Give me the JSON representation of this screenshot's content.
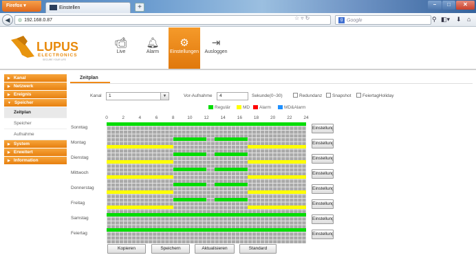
{
  "browser": {
    "firefox_button": "Firefox",
    "tab_title": "Einstellen",
    "url": "192.168.0.87",
    "search_placeholder": "Google",
    "search_engine_letter": "g",
    "new_tab_label": "+"
  },
  "header": {
    "logo_name": "LUPUS",
    "logo_sub": "ELECTRONICS",
    "logo_tag": "SECURE YOUR LIFE",
    "nav": [
      {
        "label": "Live",
        "icon": "camera-icon",
        "active": false
      },
      {
        "label": "Alarm",
        "icon": "bell-icon",
        "active": false
      },
      {
        "label": "Einstellungen",
        "icon": "settings-icon",
        "active": true
      },
      {
        "label": "Ausloggen",
        "icon": "logout-icon",
        "active": false
      }
    ]
  },
  "sidebar": {
    "groups": [
      {
        "label": "Kanal",
        "expanded": false
      },
      {
        "label": "Netzwerk",
        "expanded": false
      },
      {
        "label": "Ereignis",
        "expanded": false
      },
      {
        "label": "Speicher",
        "expanded": true,
        "items": [
          "Zeitplan",
          "Speicher",
          "Aufnahme"
        ],
        "active_item": "Zeitplan"
      },
      {
        "label": "System",
        "expanded": false
      },
      {
        "label": "Erweitert",
        "expanded": false
      },
      {
        "label": "Information",
        "expanded": false
      }
    ]
  },
  "content": {
    "tab": "Zeitplan",
    "kanal_label": "Kanal",
    "kanal_value": "1",
    "prerecord_label": "Vor-Aufnahme",
    "prerecord_value": "4",
    "prerecord_unit": "Sekunde(0~30)",
    "checkboxes": [
      "Redundanz",
      "Snapshot",
      "FeiertagHoliday"
    ],
    "legend": [
      {
        "label": "Regulär",
        "color": "#00dd00"
      },
      {
        "label": "MD",
        "color": "#ffff00"
      },
      {
        "label": "Alarm",
        "color": "#ff0000"
      },
      {
        "label": "MD&Alarm",
        "color": "#1e90ff"
      }
    ],
    "hours": [
      "0",
      "2",
      "4",
      "6",
      "8",
      "10",
      "12",
      "14",
      "16",
      "18",
      "20",
      "22",
      "24"
    ],
    "setting_button": "Einstellung",
    "days": [
      {
        "name": "Sonntag",
        "green": [
          [
            0,
            24
          ]
        ],
        "yellow": []
      },
      {
        "name": "Montag",
        "green": [
          [
            8,
            12
          ],
          [
            13,
            17
          ]
        ],
        "yellow": [
          [
            0,
            8
          ],
          [
            17,
            24
          ]
        ]
      },
      {
        "name": "Dienstag",
        "green": [
          [
            8,
            12
          ],
          [
            13,
            17
          ]
        ],
        "yellow": [
          [
            0,
            8
          ],
          [
            17,
            24
          ]
        ]
      },
      {
        "name": "Mittwoch",
        "green": [
          [
            8,
            12
          ],
          [
            13,
            17
          ]
        ],
        "yellow": [
          [
            0,
            8
          ],
          [
            17,
            24
          ]
        ]
      },
      {
        "name": "Donnerstag",
        "green": [
          [
            8,
            12
          ],
          [
            13,
            17
          ]
        ],
        "yellow": [
          [
            0,
            8
          ],
          [
            17,
            24
          ]
        ]
      },
      {
        "name": "Freitag",
        "green": [
          [
            8,
            12
          ],
          [
            13,
            17
          ]
        ],
        "yellow": [
          [
            0,
            8
          ],
          [
            17,
            24
          ]
        ]
      },
      {
        "name": "Samstag",
        "green": [
          [
            0,
            24
          ]
        ],
        "yellow": []
      },
      {
        "name": "Feiertag",
        "green": [
          [
            0,
            24
          ]
        ],
        "yellow": []
      }
    ],
    "actions": [
      "Kopieren",
      "Speichern",
      "Aktualisieren",
      "Standard"
    ]
  }
}
